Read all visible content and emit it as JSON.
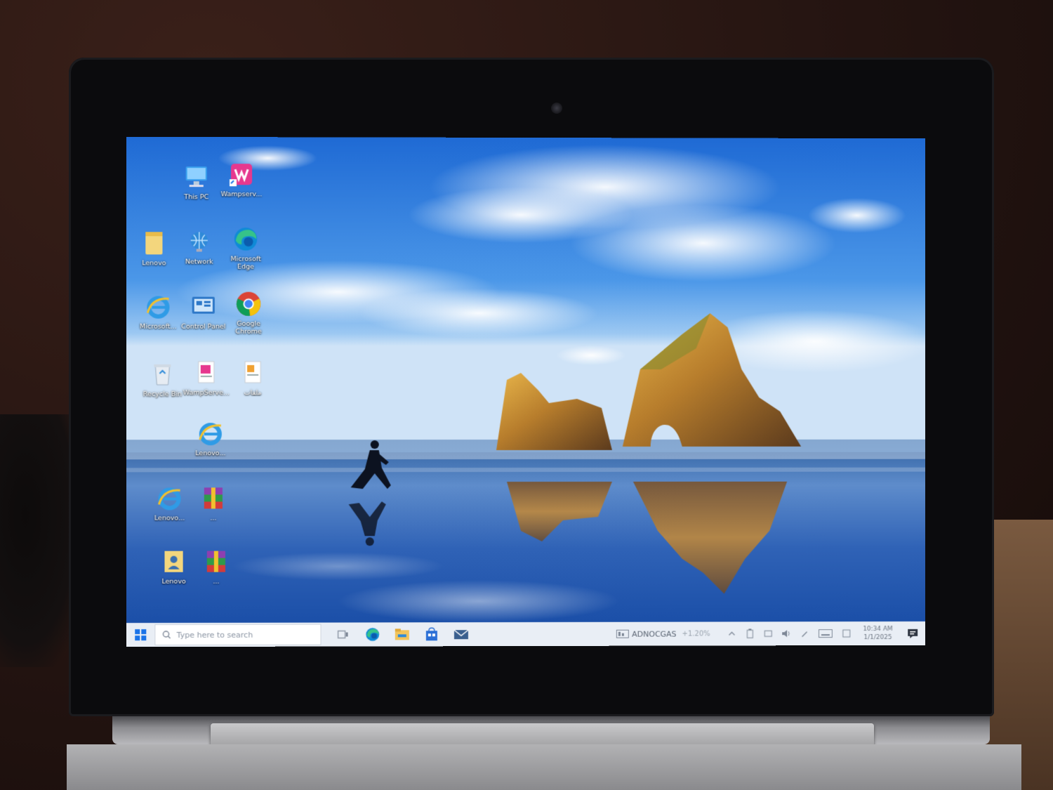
{
  "desktop": {
    "icons": [
      {
        "id": "this-pc",
        "label": "This PC"
      },
      {
        "id": "wampserver",
        "label": "Wampserv..."
      },
      {
        "id": "lenovo-folder",
        "label": "Lenovo"
      },
      {
        "id": "network",
        "label": "Network"
      },
      {
        "id": "edge",
        "label": "Microsoft Edge"
      },
      {
        "id": "ie",
        "label": "Microsoft..."
      },
      {
        "id": "control-panel",
        "label": "Control Panel"
      },
      {
        "id": "chrome",
        "label": "Google Chrome"
      },
      {
        "id": "recycle-bin",
        "label": "Recycle Bin"
      },
      {
        "id": "wampserver-doc",
        "label": "WampServe..."
      },
      {
        "id": "arabic-file",
        "label": "ملفات"
      },
      {
        "id": "ie-2",
        "label": "Lenovo..."
      },
      {
        "id": "ie-3",
        "label": "Lenovo..."
      },
      {
        "id": "winrar-1",
        "label": "..."
      },
      {
        "id": "lenovo-user",
        "label": "Lenovo"
      },
      {
        "id": "winrar-2",
        "label": "..."
      }
    ]
  },
  "taskbar": {
    "search_placeholder": "Type here to search",
    "stock_ticker": "ADNOCGAS",
    "stock_change": "+1.20%",
    "clock_time": "10:34 AM",
    "clock_date": "1/1/2025"
  },
  "colors": {
    "taskbar_bg": "#e9eef5",
    "windows_blue": "#1a73e8"
  }
}
